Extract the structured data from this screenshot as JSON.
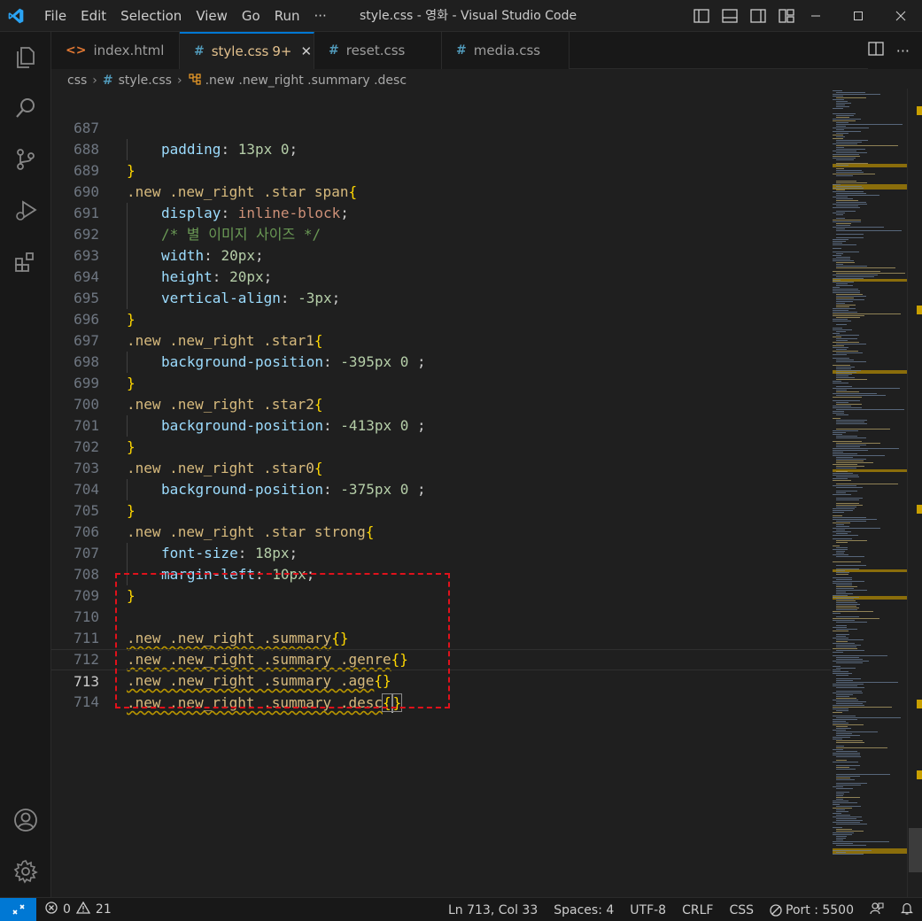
{
  "window": {
    "title": "style.css - 영화 - Visual Studio Code",
    "menu": [
      "File",
      "Edit",
      "Selection",
      "View",
      "Go",
      "Run",
      "···"
    ]
  },
  "tabs": [
    {
      "icon": "<>",
      "label": "index.html",
      "active": false
    },
    {
      "icon": "#",
      "label": "style.css",
      "badge": "9+",
      "active": true
    },
    {
      "icon": "#",
      "label": "reset.css",
      "active": false
    },
    {
      "icon": "#",
      "label": "media.css",
      "active": false
    }
  ],
  "breadcrumb": {
    "folder": "css",
    "file": "style.css",
    "symbol": ".new .new_right .summary .desc"
  },
  "editor": {
    "lines": [
      {
        "n": "687",
        "text": "    padding: 13px 0;"
      },
      {
        "n": "688",
        "text": "}"
      },
      {
        "n": "689",
        "text": ".new .new_right .star span{"
      },
      {
        "n": "690",
        "text": "    display: inline-block;"
      },
      {
        "n": "691",
        "text": "    /* 별 이미지 사이즈 */"
      },
      {
        "n": "692",
        "text": "    width: 20px;"
      },
      {
        "n": "693",
        "text": "    height: 20px;"
      },
      {
        "n": "694",
        "text": "    vertical-align: -3px;"
      },
      {
        "n": "695",
        "text": "}"
      },
      {
        "n": "696",
        "text": ".new .new_right .star1{"
      },
      {
        "n": "697",
        "text": "    background-position: -395px 0 ;"
      },
      {
        "n": "698",
        "text": "}"
      },
      {
        "n": "699",
        "text": ".new .new_right .star2{"
      },
      {
        "n": "700",
        "text": "    background-position: -413px 0 ;"
      },
      {
        "n": "701",
        "text": "}"
      },
      {
        "n": "702",
        "text": ".new .new_right .star0{"
      },
      {
        "n": "703",
        "text": "    background-position: -375px 0 ;"
      },
      {
        "n": "704",
        "text": "}"
      },
      {
        "n": "705",
        "text": ".new .new_right .star strong{"
      },
      {
        "n": "706",
        "text": "    font-size: 18px;"
      },
      {
        "n": "707",
        "text": "    margin-left: 10px;"
      },
      {
        "n": "708",
        "text": "}"
      },
      {
        "n": "709",
        "text": ""
      },
      {
        "n": "710",
        "text": ".new .new_right .summary{}"
      },
      {
        "n": "711",
        "text": ".new .new_right .summary .genre{}"
      },
      {
        "n": "712",
        "text": ".new .new_right .summary .age{}"
      },
      {
        "n": "713",
        "text": ".new .new_right .summary .desc{}"
      },
      {
        "n": "714",
        "text": ""
      }
    ],
    "current_line": "713"
  },
  "statusbar": {
    "problems_errors": "0",
    "problems_warnings": "21",
    "position": "Ln 713, Col 33",
    "spaces": "Spaces: 4",
    "encoding": "UTF-8",
    "eol": "CRLF",
    "language": "CSS",
    "port": "Port : 5500"
  },
  "colors": {
    "accent": "#0078d4",
    "selector": "#d7ba7d",
    "property": "#9cdcfe",
    "number": "#b5cea8",
    "comment": "#6a9955",
    "highlight_box": "#e0111b"
  }
}
